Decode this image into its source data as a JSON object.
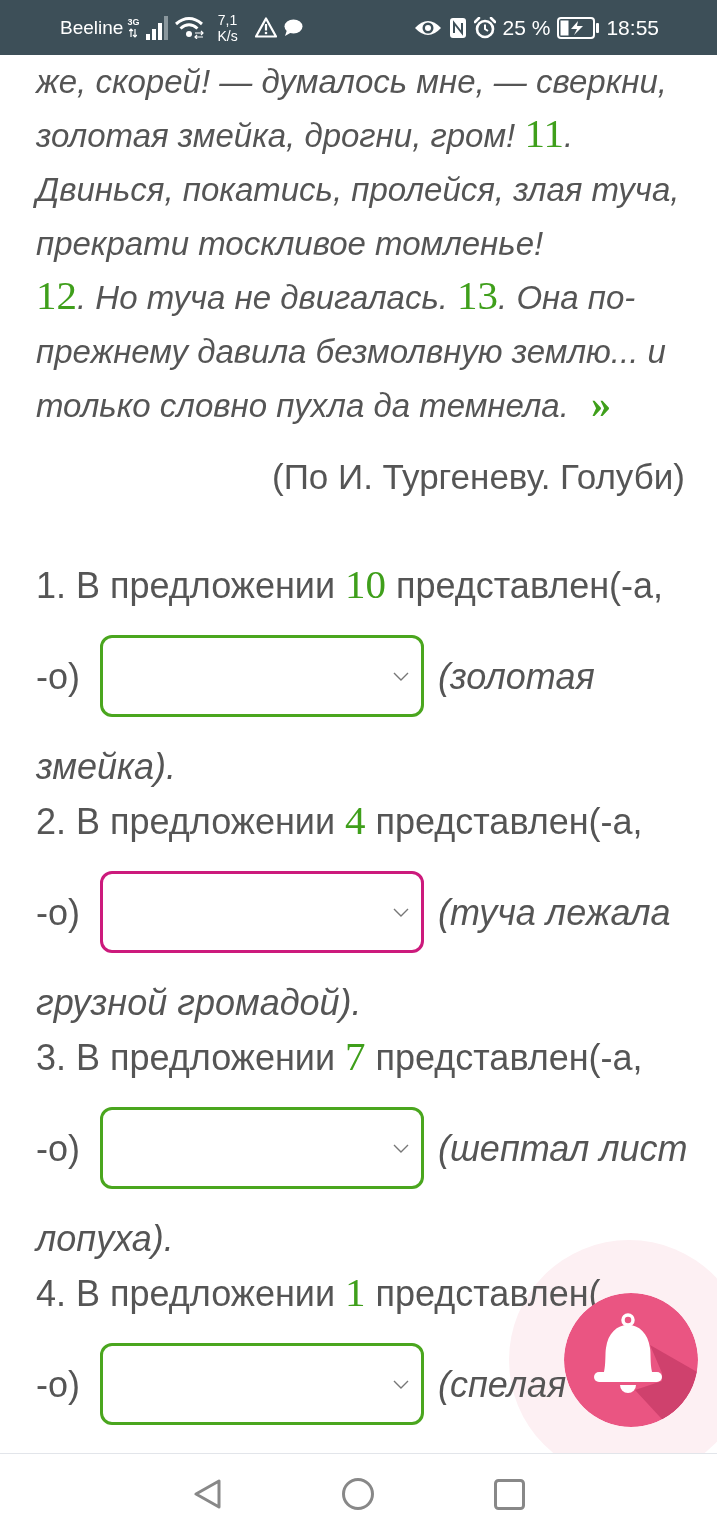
{
  "status_bar": {
    "carrier": "Beeline",
    "network_type": "3G",
    "speed": "7,1",
    "speed_unit": "K/s",
    "battery": "25 %",
    "time": "18:55"
  },
  "passage": {
    "paragraphs": [
      [
        {
          "kind": "text",
          "text": "же, скорей! — думалось мне, — сверкни, золотая змейка, дрогни, гром! "
        },
        {
          "kind": "number",
          "text": "11"
        },
        {
          "kind": "text",
          "text": ". Двинься, покатись, пролейся, злая туча, прекрати тоскливое томленье!"
        }
      ],
      [
        {
          "kind": "number",
          "text": "12"
        },
        {
          "kind": "text",
          "text": ". Но туча не двигалась. "
        },
        {
          "kind": "number",
          "text": "13"
        },
        {
          "kind": "text",
          "text": ". Она по-прежнему давила безмолвную землю... и только словно пухла да темнела."
        },
        {
          "kind": "quote",
          "text": "»"
        }
      ]
    ],
    "source": "(По И. Тургеневу. Голуби)"
  },
  "questions": [
    {
      "text": "1. В предложении",
      "sentence": "10",
      "text_after": "представлен(-а,",
      "text_wrapped": "-о)",
      "dropdown": {
        "color": "#4aa61e"
      },
      "hint": "(золотая",
      "hint_wrapped": "змейка)."
    },
    {
      "text": "2. В предложении",
      "sentence": "4",
      "text_after": "представлен(-а,",
      "text_wrapped": "-о)",
      "dropdown": {
        "color": "#cc1a7c"
      },
      "hint": "(туча лежала",
      "hint_wrapped": "грузной громадой)."
    },
    {
      "text": "3. В предложении",
      "sentence": "7",
      "text_after": "представлен(-а,",
      "text_wrapped": "-о)",
      "dropdown": {
        "color": "#4aa61e"
      },
      "hint": "(шептал лист",
      "hint_wrapped": "лопуха)."
    },
    {
      "text": "4. В предложении",
      "sentence": "1",
      "text_after": "представлен(",
      "text_wrapped": "-о)",
      "dropdown": {
        "color": "#4aa61e"
      },
      "hint": "(спелая"
    }
  ]
}
